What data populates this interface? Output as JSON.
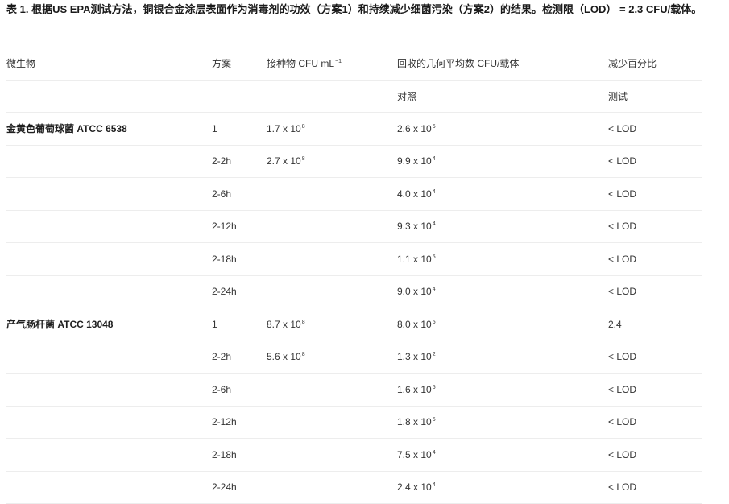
{
  "caption": "表 1. 根据US EPA测试方法，铜银合金涂层表面作为消毒剂的功效（方案1）和持续减少细菌污染（方案2）的结果。检测限（LOD） = 2.3 CFU/载体。",
  "headers": {
    "organism": "微生物",
    "scheme": "方案",
    "inoculum": "接种物 CFU mL",
    "inoculum_exp": "−1",
    "recovered": "回收的几何平均数 CFU/载体",
    "reduction": "减少百分比",
    "control": "对照",
    "test": "测试"
  },
  "rows": [
    {
      "org": "金黄色葡萄球菌 ATCC 6538",
      "scheme": "1",
      "inoc_m": "1.7 x 10",
      "inoc_e": "8",
      "ctrl_m": "2.6 x 10",
      "ctrl_e": "5",
      "red": "< LOD"
    },
    {
      "org": "",
      "scheme": "2-2h",
      "inoc_m": "2.7 x 10",
      "inoc_e": "8",
      "ctrl_m": "9.9 x 10",
      "ctrl_e": "4",
      "red": "< LOD"
    },
    {
      "org": "",
      "scheme": "2-6h",
      "inoc_m": "",
      "inoc_e": "",
      "ctrl_m": "4.0 x 10",
      "ctrl_e": "4",
      "red": "< LOD"
    },
    {
      "org": "",
      "scheme": "2-12h",
      "inoc_m": "",
      "inoc_e": "",
      "ctrl_m": "9.3 x 10",
      "ctrl_e": "4",
      "red": "< LOD"
    },
    {
      "org": "",
      "scheme": "2-18h",
      "inoc_m": "",
      "inoc_e": "",
      "ctrl_m": "1.1 x 10",
      "ctrl_e": "5",
      "red": "< LOD"
    },
    {
      "org": "",
      "scheme": "2-24h",
      "inoc_m": "",
      "inoc_e": "",
      "ctrl_m": "9.0 x 10",
      "ctrl_e": "4",
      "red": "< LOD"
    },
    {
      "org": "产气肠杆菌 ATCC 13048",
      "scheme": "1",
      "inoc_m": "8.7 x 10",
      "inoc_e": "8",
      "ctrl_m": "8.0 x 10",
      "ctrl_e": "5",
      "red": "2.4"
    },
    {
      "org": "",
      "scheme": "2-2h",
      "inoc_m": "5.6 x 10",
      "inoc_e": "8",
      "ctrl_m": "1.3 x 10",
      "ctrl_e": "2",
      "red": "< LOD"
    },
    {
      "org": "",
      "scheme": "2-6h",
      "inoc_m": "",
      "inoc_e": "",
      "ctrl_m": "1.6 x 10",
      "ctrl_e": "5",
      "red": "< LOD"
    },
    {
      "org": "",
      "scheme": "2-12h",
      "inoc_m": "",
      "inoc_e": "",
      "ctrl_m": "1.8 x 10",
      "ctrl_e": "5",
      "red": "< LOD"
    },
    {
      "org": "",
      "scheme": "2-18h",
      "inoc_m": "",
      "inoc_e": "",
      "ctrl_m": "7.5 x 10",
      "ctrl_e": "4",
      "red": "< LOD"
    },
    {
      "org": "",
      "scheme": "2-24h",
      "inoc_m": "",
      "inoc_e": "",
      "ctrl_m": "2.4 x 10",
      "ctrl_e": "4",
      "red": "< LOD"
    }
  ]
}
